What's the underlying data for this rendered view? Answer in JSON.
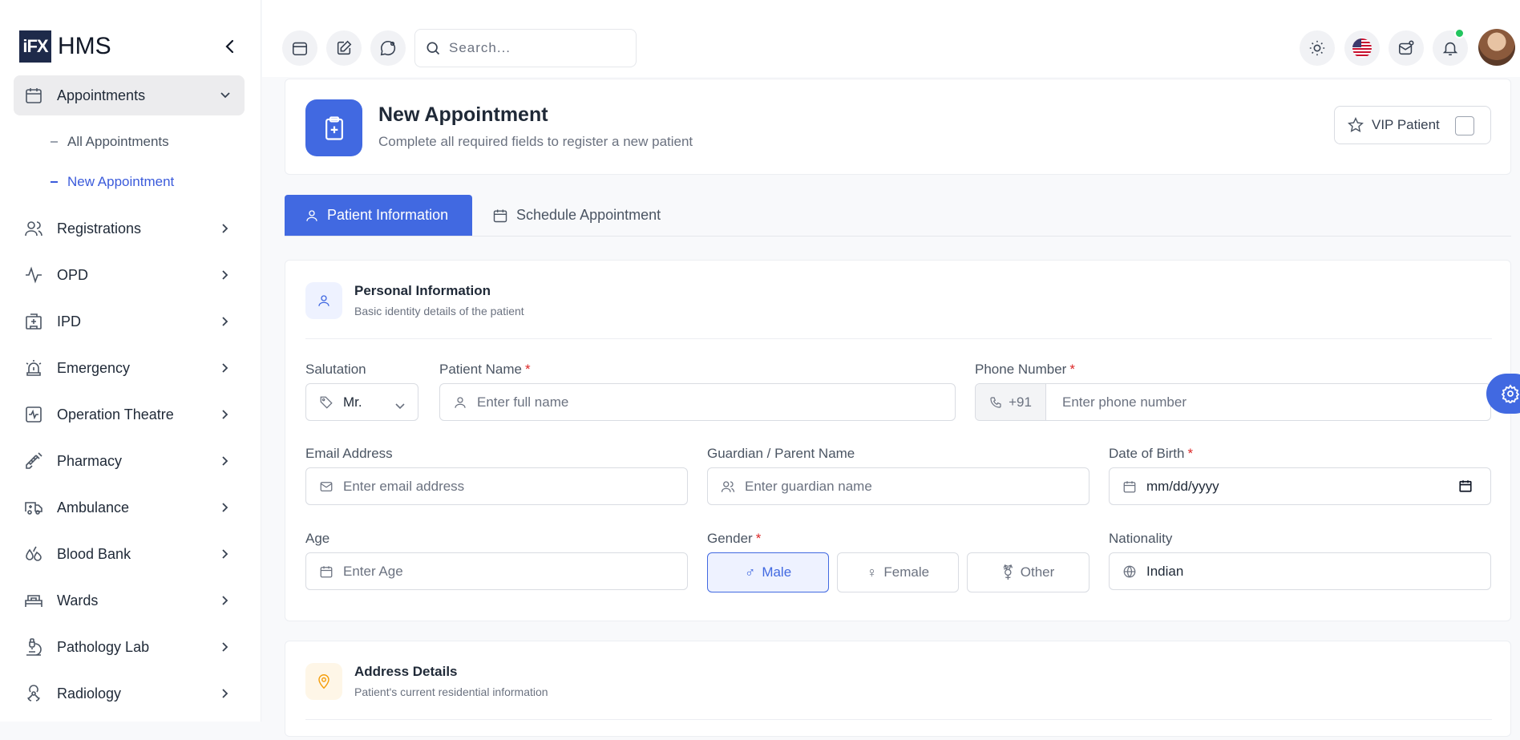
{
  "brand": {
    "logo_text": "iFX",
    "name": "HMS"
  },
  "sidebar": {
    "items": [
      {
        "label": "Appointments",
        "icon": "calendar-icon",
        "active": true,
        "expanded": true,
        "children": [
          {
            "label": "All Appointments",
            "active": false
          },
          {
            "label": "New Appointment",
            "active": true
          }
        ]
      },
      {
        "label": "Registrations",
        "icon": "users-icon"
      },
      {
        "label": "OPD",
        "icon": "activity-icon"
      },
      {
        "label": "IPD",
        "icon": "hospital-icon"
      },
      {
        "label": "Emergency",
        "icon": "siren-icon"
      },
      {
        "label": "Operation Theatre",
        "icon": "monitor-heart-icon"
      },
      {
        "label": "Pharmacy",
        "icon": "syringe-icon"
      },
      {
        "label": "Ambulance",
        "icon": "ambulance-icon"
      },
      {
        "label": "Blood Bank",
        "icon": "droplets-icon"
      },
      {
        "label": "Wards",
        "icon": "bed-icon"
      },
      {
        "label": "Pathology Lab",
        "icon": "microscope-icon"
      },
      {
        "label": "Radiology",
        "icon": "radiation-icon"
      }
    ]
  },
  "topbar": {
    "search_placeholder": "Search...",
    "left_icons": [
      "calendar-icon",
      "edit-icon",
      "chat-icon"
    ],
    "right_icons": [
      "sun-icon",
      "us-flag-icon",
      "mail-icon",
      "bell-icon"
    ]
  },
  "header": {
    "title": "New Appointment",
    "subtitle": "Complete all required fields to register a new patient",
    "vip_label": "VIP Patient"
  },
  "tabs": [
    {
      "label": "Patient Information",
      "active": true
    },
    {
      "label": "Schedule Appointment",
      "active": false
    }
  ],
  "personal": {
    "title": "Personal Information",
    "subtitle": "Basic identity details of the patient",
    "salutation": {
      "label": "Salutation",
      "value": "Mr."
    },
    "patient_name": {
      "label": "Patient Name",
      "placeholder": "Enter full name"
    },
    "phone": {
      "label": "Phone Number",
      "prefix": "+91",
      "placeholder": "Enter phone number"
    },
    "email": {
      "label": "Email Address",
      "placeholder": "Enter email address"
    },
    "guardian": {
      "label": "Guardian / Parent Name",
      "placeholder": "Enter guardian name"
    },
    "dob": {
      "label": "Date of Birth",
      "placeholder": "mm/dd/yyyy"
    },
    "age": {
      "label": "Age",
      "placeholder": "Enter Age"
    },
    "gender": {
      "label": "Gender",
      "options": [
        "Male",
        "Female",
        "Other"
      ],
      "selected": "Male"
    },
    "nationality": {
      "label": "Nationality",
      "value": "Indian"
    },
    "required_mark": "*"
  },
  "address": {
    "title": "Address Details",
    "subtitle": "Patient's current residential information"
  },
  "colors": {
    "primary": "#4169e1",
    "required": "#dc2626",
    "online": "#22c55e",
    "address_accent": "#f59e0b"
  }
}
